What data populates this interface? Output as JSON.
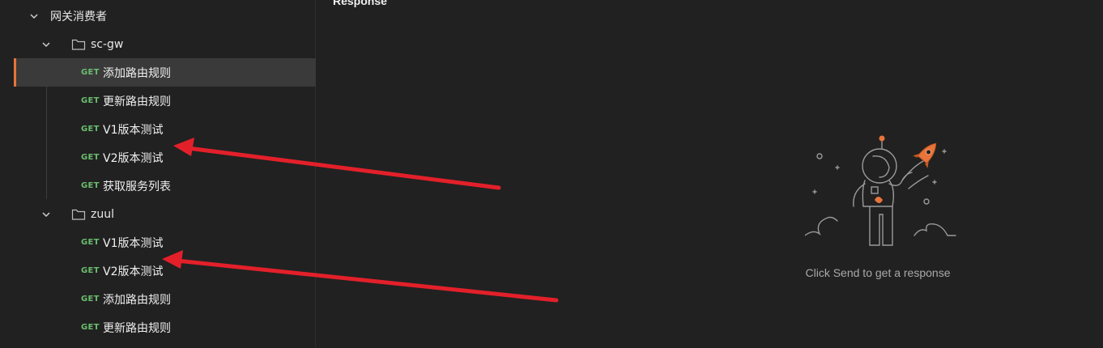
{
  "sidebar": {
    "root": {
      "label": "网关消费者"
    },
    "folders": [
      {
        "label": "sc-gw",
        "requests": [
          {
            "method": "GET",
            "name": "添加路由规则"
          },
          {
            "method": "GET",
            "name": "更新路由规则"
          },
          {
            "method": "GET",
            "name": "V1版本测试"
          },
          {
            "method": "GET",
            "name": "V2版本测试"
          },
          {
            "method": "GET",
            "name": "获取服务列表"
          }
        ]
      },
      {
        "label": "zuul",
        "requests": [
          {
            "method": "GET",
            "name": "V1版本测试"
          },
          {
            "method": "GET",
            "name": "V2版本测试"
          },
          {
            "method": "GET",
            "name": "添加路由规则"
          },
          {
            "method": "GET",
            "name": "更新路由规则"
          }
        ]
      }
    ]
  },
  "response": {
    "title": "Response",
    "empty_message": "Click Send to get a response",
    "illustration_icon": "astronaut-rocket-icon"
  },
  "colors": {
    "background": "#212121",
    "selected_row": "#3a3a3a",
    "accent": "#e8743b",
    "get_method": "#6bbd6e",
    "annotation_arrow": "#e3202a"
  }
}
